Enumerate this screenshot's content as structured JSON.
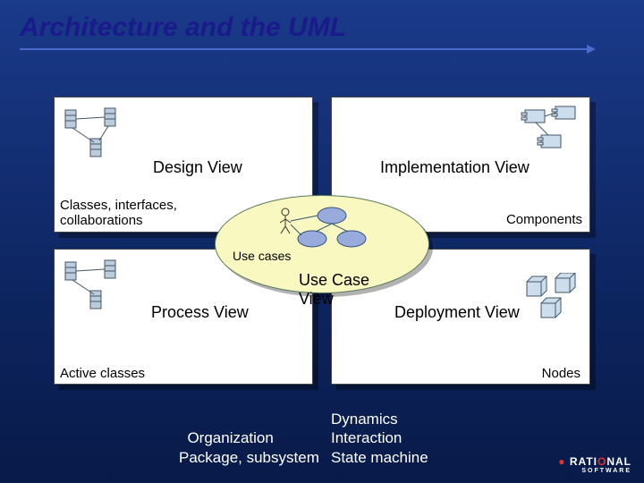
{
  "title": "Architecture and the UML",
  "views": {
    "design": {
      "name": "Design View",
      "sub": "Classes, interfaces,\ncollaborations"
    },
    "implementation": {
      "name": "Implementation View",
      "sub": "Components"
    },
    "process": {
      "name": "Process View",
      "sub": "Active classes"
    },
    "deployment": {
      "name": "Deployment View",
      "sub": "Nodes"
    },
    "usecase": {
      "name": "Use Case\nView",
      "sub": "Use cases"
    }
  },
  "footer": {
    "col1": "Organization\nPackage, subsystem",
    "col2": "Dynamics\nInteraction\nState machine"
  },
  "logo": {
    "brand1": "RATI",
    "brand2": "O",
    "brand3": "NAL",
    "sub": "SOFTWARE"
  }
}
